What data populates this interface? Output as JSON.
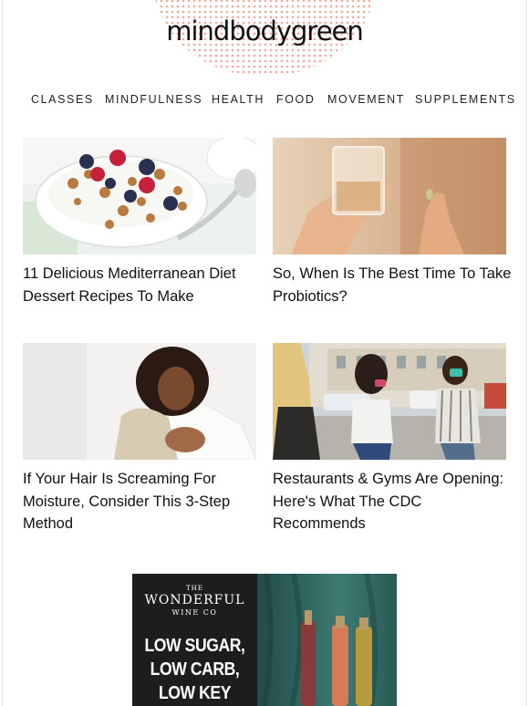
{
  "header": {
    "logo": "mindbodygreen"
  },
  "nav": {
    "items": [
      "CLASSES",
      "MINDFULNESS",
      "HEALTH",
      "FOOD",
      "MOVEMENT",
      "SUPPLEMENTS"
    ]
  },
  "articles": [
    {
      "title": "11 Delicious Mediterranean Diet Dessert Recipes To Make"
    },
    {
      "title": "So, When Is The Best Time To Take Probiotics?"
    },
    {
      "title": "If Your Hair Is Screaming For Moisture, Consider This 3-Step Method"
    },
    {
      "title": "Restaurants & Gyms Are Opening: Here's What The CDC Recommends"
    }
  ],
  "ad": {
    "brand_the": "THE",
    "brand_name": "WONDERFUL",
    "brand_wine": "WINE CO",
    "lines": [
      "LOW SUGAR,",
      "LOW CARB,",
      "LOW KEY"
    ]
  }
}
